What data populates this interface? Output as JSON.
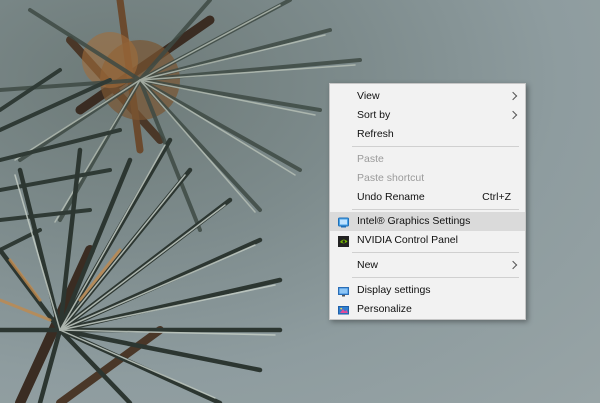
{
  "context_menu": {
    "items": [
      {
        "label": "View",
        "submenu": true
      },
      {
        "label": "Sort by",
        "submenu": true
      },
      {
        "label": "Refresh"
      },
      {
        "label": "Paste",
        "disabled": true
      },
      {
        "label": "Paste shortcut",
        "disabled": true
      },
      {
        "label": "Undo Rename",
        "shortcut": "Ctrl+Z"
      },
      {
        "label": "Intel® Graphics Settings",
        "icon": "intel-graphics-icon",
        "highlighted": true
      },
      {
        "label": "NVIDIA Control Panel",
        "icon": "nvidia-icon"
      },
      {
        "label": "New",
        "submenu": true
      },
      {
        "label": "Display settings",
        "icon": "display-icon"
      },
      {
        "label": "Personalize",
        "icon": "personalize-icon"
      }
    ]
  },
  "colors": {
    "menu_background": "#f2f2f2",
    "highlight": "#dadada",
    "disabled_text": "#9b9b9b",
    "nvidia_green": "#76b900",
    "intel_blue": "#1f7fd1"
  }
}
